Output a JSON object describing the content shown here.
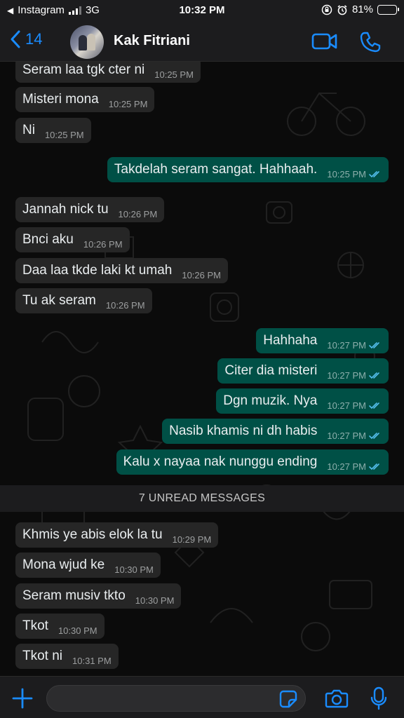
{
  "status_bar": {
    "back_app": "Instagram",
    "network": "3G",
    "time": "10:32 PM",
    "battery": "81%",
    "battery_level": 0.81
  },
  "header": {
    "back_count": "14",
    "contact_name": "Kak Fitriani"
  },
  "colors": {
    "accent": "#1a8cff",
    "incoming_bubble": "#262626",
    "outgoing_bubble": "#005046",
    "read_ticks": "#53bdeb"
  },
  "chat": {
    "messages_before": [
      {
        "dir": "in",
        "text": "Seram laa tgk cter ni",
        "time": "10:25 PM"
      },
      {
        "dir": "in",
        "text": "Misteri mona",
        "time": "10:25 PM"
      },
      {
        "dir": "in",
        "text": "Ni",
        "time": "10:25 PM"
      },
      {
        "dir": "out",
        "text": "Takdelah seram sangat. Hahhaah.",
        "time": "10:25 PM"
      },
      {
        "dir": "in",
        "text": "Jannah nick tu",
        "time": "10:26 PM"
      },
      {
        "dir": "in",
        "text": "Bnci aku",
        "time": "10:26 PM"
      },
      {
        "dir": "in",
        "text": "Daa laa tkde laki kt umah",
        "time": "10:26 PM"
      },
      {
        "dir": "in",
        "text": "Tu ak seram",
        "time": "10:26 PM"
      },
      {
        "dir": "out",
        "text": "Hahhaha",
        "time": "10:27 PM"
      },
      {
        "dir": "out",
        "text": "Citer dia misteri",
        "time": "10:27 PM"
      },
      {
        "dir": "out",
        "text": "Dgn muzik. Nya",
        "time": "10:27 PM"
      },
      {
        "dir": "out",
        "text": "Nasib khamis ni dh habis",
        "time": "10:27 PM"
      },
      {
        "dir": "out",
        "text": "Kalu x nayaa nak nunggu ending",
        "time": "10:27 PM"
      }
    ],
    "unread_label": "7 UNREAD MESSAGES",
    "messages_after": [
      {
        "dir": "in",
        "text": "Khmis ye abis elok la tu",
        "time": "10:29 PM"
      },
      {
        "dir": "in",
        "text": "Mona wjud ke",
        "time": "10:30 PM"
      },
      {
        "dir": "in",
        "text": "Seram musiv tkto",
        "time": "10:30 PM"
      },
      {
        "dir": "in",
        "text": "Tkot",
        "time": "10:30 PM"
      },
      {
        "dir": "in",
        "text": "Tkot ni",
        "time": "10:31 PM"
      }
    ]
  },
  "composer": {
    "input_value": "",
    "placeholder": ""
  },
  "icons": {
    "back": "chevron-left-icon",
    "video": "video-camera-icon",
    "call": "phone-icon",
    "attach": "plus-icon",
    "sticker": "sticker-icon",
    "camera": "camera-icon",
    "mic": "microphone-icon"
  }
}
